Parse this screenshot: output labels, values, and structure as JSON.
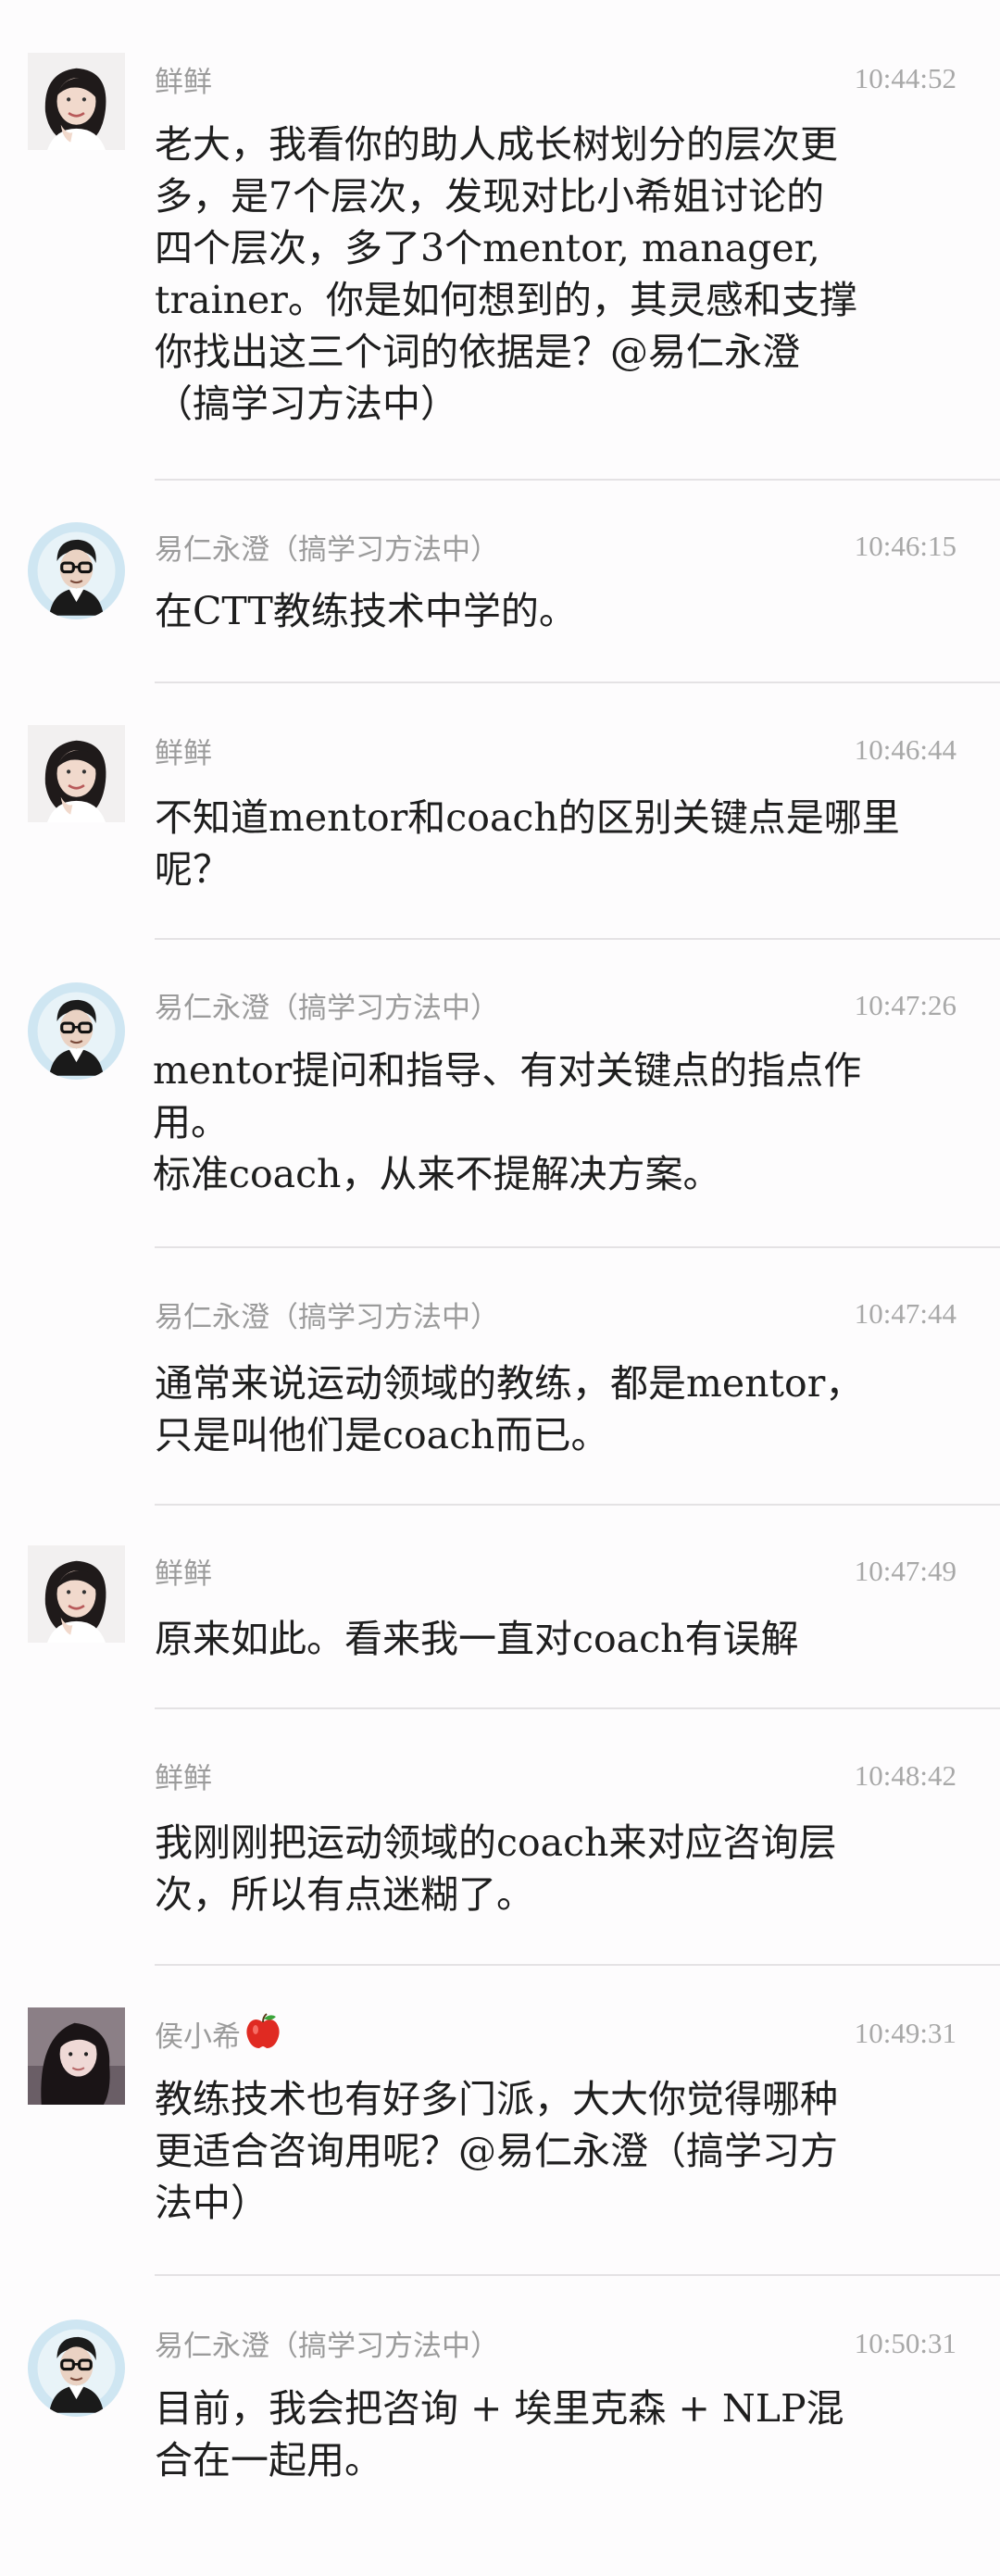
{
  "messages": [
    {
      "sender": "鲜鲜",
      "time": "10:44:52",
      "avatar": "woman-portrait-avatar",
      "lines": [
        "老大，我看你的助人成长树划分的层次更",
        "多，是7个层次，发现对比小希姐讨论的",
        "四个层次，多了3个mentor, manager,",
        "trainer。你是如何想到的，其灵感和支撑",
        "你找出这三个词的依据是？@易仁永澄",
        "（搞学习方法中）"
      ]
    },
    {
      "sender": "易仁永澄（搞学习方法中）",
      "time": "10:46:15",
      "avatar": "man-glasses-avatar",
      "lines": [
        "在CTT教练技术中学的。"
      ]
    },
    {
      "sender": "鲜鲜",
      "time": "10:46:44",
      "avatar": "woman-portrait-avatar",
      "lines": [
        "不知道mentor和coach的区别关键点是哪里",
        "呢？"
      ]
    },
    {
      "sender": "易仁永澄（搞学习方法中）",
      "time": "10:47:26",
      "avatar": "man-glasses-avatar",
      "lines": [
        "mentor提问和指导、有对关键点的指点作",
        "用。",
        "标准coach，从来不提解决方案。"
      ]
    },
    {
      "sender": "易仁永澄（搞学习方法中）",
      "time": "10:47:44",
      "avatar": "",
      "lines": [
        "通常来说运动领域的教练，都是mentor，",
        "只是叫他们是coach而已。"
      ]
    },
    {
      "sender": "鲜鲜",
      "time": "10:47:49",
      "avatar": "woman-portrait-avatar",
      "lines": [
        "原来如此。看来我一直对coach有误解"
      ]
    },
    {
      "sender": "鲜鲜",
      "time": "10:48:42",
      "avatar": "",
      "lines": [
        "我刚刚把运动领域的coach来对应咨询层",
        "次，所以有点迷糊了。"
      ]
    },
    {
      "sender": "侯小希",
      "sender_icon": "apple-icon",
      "time": "10:49:31",
      "avatar": "woman-long-hair-avatar",
      "lines": [
        "教练技术也有好多门派，大大你觉得哪种",
        "更适合咨询用呢？@易仁永澄（搞学习方",
        "法中）"
      ]
    },
    {
      "sender": "易仁永澄（搞学习方法中）",
      "time": "10:50:31",
      "avatar": "man-glasses-avatar",
      "lines": [
        "目前，我会把咨询 + 埃里克森 + NLP混",
        "合在一起用。"
      ]
    }
  ],
  "colors": {
    "background": "#fdfcfd",
    "meta_text": "#9b9b9b",
    "body_text": "#1e1e1e",
    "divider": "#e4e2e4"
  }
}
